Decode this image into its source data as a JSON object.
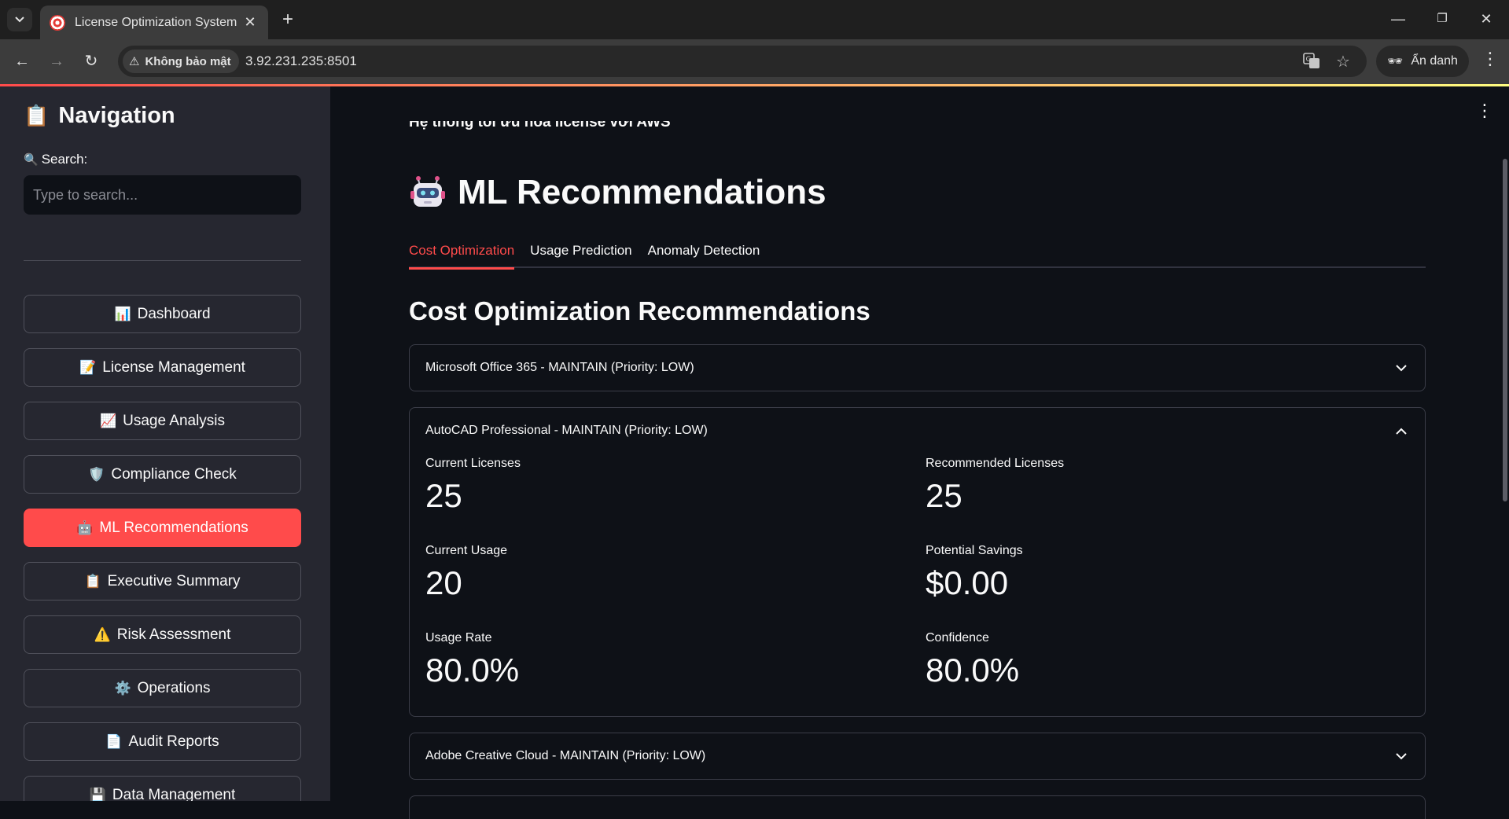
{
  "browser": {
    "tab_title": "License Optimization System",
    "security_label": "Không bảo mật",
    "url": "3.92.231.235:8501",
    "incognito_label": "Ẩn danh"
  },
  "sidebar": {
    "title": "Navigation",
    "title_icon": "📋",
    "search_label": "Search:",
    "search_icon": "🔍",
    "search_placeholder": "Type to search...",
    "items": [
      {
        "icon": "📊",
        "label": "Dashboard"
      },
      {
        "icon": "📝",
        "label": "License Management"
      },
      {
        "icon": "📈",
        "label": "Usage Analysis"
      },
      {
        "icon": "🛡️",
        "label": "Compliance Check"
      },
      {
        "icon": "🤖",
        "label": "ML Recommendations",
        "active": true
      },
      {
        "icon": "📋",
        "label": "Executive Summary"
      },
      {
        "icon": "⚠️",
        "label": "Risk Assessment"
      },
      {
        "icon": "⚙️",
        "label": "Operations"
      },
      {
        "icon": "📄",
        "label": "Audit Reports"
      },
      {
        "icon": "💾",
        "label": "Data Management"
      }
    ]
  },
  "main": {
    "subtitle": "Hệ thống tối ưu hóa license với AWS",
    "title": "ML Recommendations",
    "tabs": [
      "Cost Optimization",
      "Usage Prediction",
      "Anomaly Detection"
    ],
    "active_tab": "Cost Optimization",
    "section_title": "Cost Optimization Recommendations",
    "expanders": [
      {
        "title": "Microsoft Office 365 - MAINTAIN (Priority: LOW)",
        "expanded": false
      },
      {
        "title": "AutoCAD Professional - MAINTAIN (Priority: LOW)",
        "expanded": true,
        "metrics": {
          "current_licenses": {
            "label": "Current Licenses",
            "value": "25"
          },
          "recommended_licenses": {
            "label": "Recommended Licenses",
            "value": "25"
          },
          "current_usage": {
            "label": "Current Usage",
            "value": "20"
          },
          "potential_savings": {
            "label": "Potential Savings",
            "value": "$0.00"
          },
          "usage_rate": {
            "label": "Usage Rate",
            "value": "80.0%"
          },
          "confidence": {
            "label": "Confidence",
            "value": "80.0%"
          }
        }
      },
      {
        "title": "Adobe Creative Cloud - MAINTAIN (Priority: LOW)",
        "expanded": false
      }
    ]
  },
  "colors": {
    "accent": "#ff4b4b",
    "background": "#0e1117",
    "sidebar": "#262730"
  }
}
